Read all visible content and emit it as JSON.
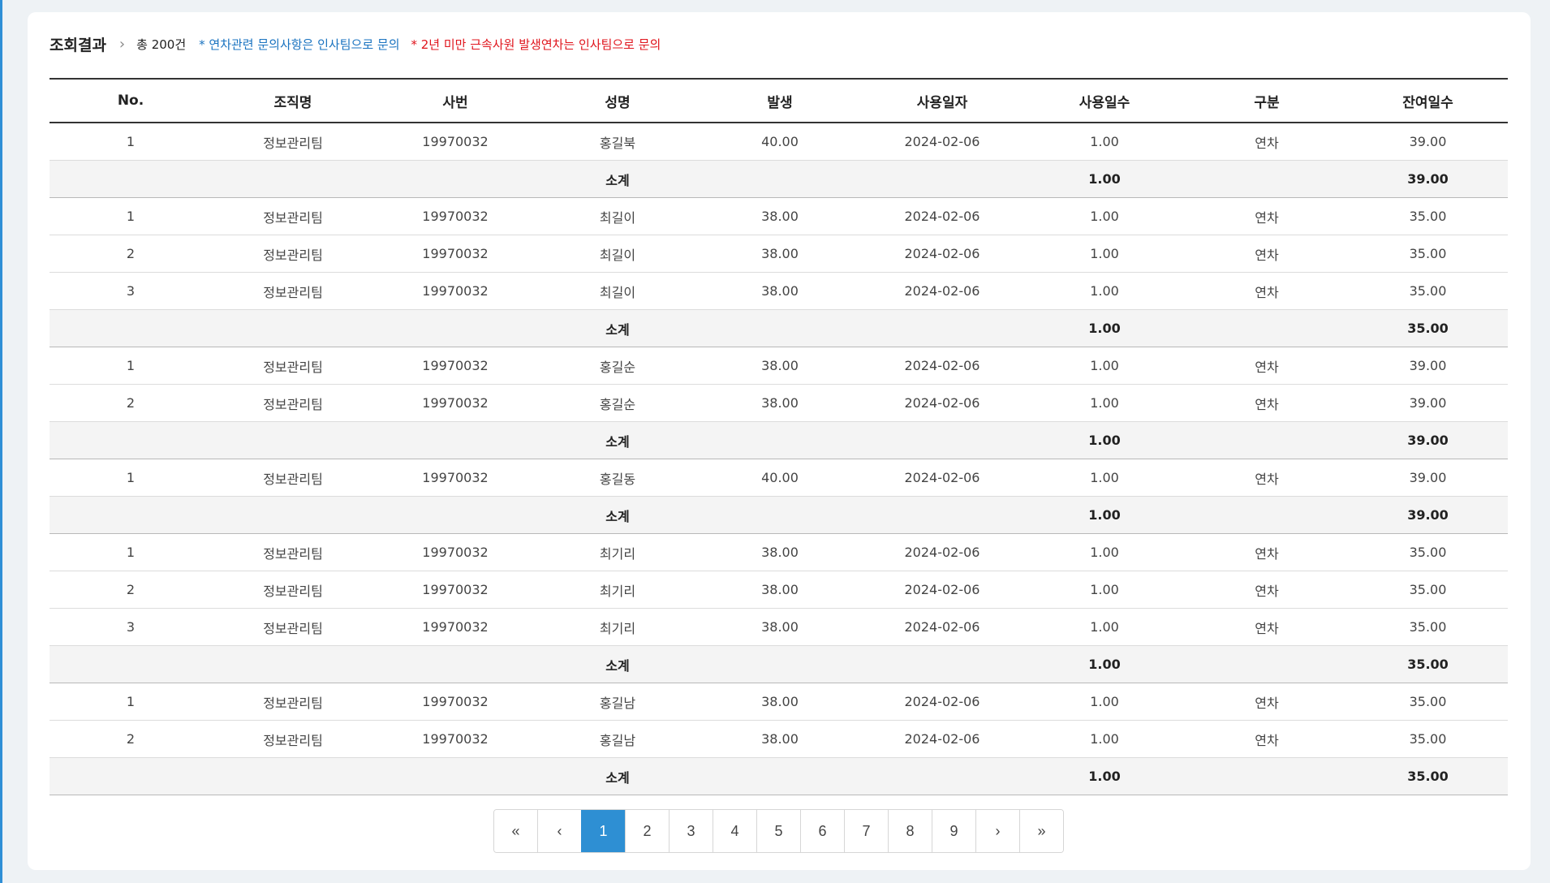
{
  "header": {
    "title": "조회결과",
    "separator": "›",
    "count": "총 200건",
    "note_blue": "* 연차관련 문의사항은 인사팀으로 문의",
    "note_red": "* 2년 미만 근속사원 발생연차는 인사팀으로 문의"
  },
  "table": {
    "columns": [
      "No.",
      "조직명",
      "사번",
      "성명",
      "발생",
      "사용일자",
      "사용일수",
      "구분",
      "잔여일수"
    ],
    "rows": [
      {
        "type": "data",
        "cells": [
          "1",
          "정보관리팀",
          "19970032",
          "홍길북",
          "40.00",
          "2024-02-06",
          "1.00",
          "연차",
          "39.00"
        ]
      },
      {
        "type": "subtotal",
        "label": "소계",
        "used": "1.00",
        "remain": "39.00"
      },
      {
        "type": "data",
        "cells": [
          "1",
          "정보관리팀",
          "19970032",
          "최길이",
          "38.00",
          "2024-02-06",
          "1.00",
          "연차",
          "35.00"
        ]
      },
      {
        "type": "data",
        "cells": [
          "2",
          "정보관리팀",
          "19970032",
          "최길이",
          "38.00",
          "2024-02-06",
          "1.00",
          "연차",
          "35.00"
        ]
      },
      {
        "type": "data",
        "cells": [
          "3",
          "정보관리팀",
          "19970032",
          "최길이",
          "38.00",
          "2024-02-06",
          "1.00",
          "연차",
          "35.00"
        ]
      },
      {
        "type": "subtotal",
        "label": "소계",
        "used": "1.00",
        "remain": "35.00"
      },
      {
        "type": "data",
        "cells": [
          "1",
          "정보관리팀",
          "19970032",
          "홍길순",
          "38.00",
          "2024-02-06",
          "1.00",
          "연차",
          "39.00"
        ]
      },
      {
        "type": "data",
        "cells": [
          "2",
          "정보관리팀",
          "19970032",
          "홍길순",
          "38.00",
          "2024-02-06",
          "1.00",
          "연차",
          "39.00"
        ]
      },
      {
        "type": "subtotal",
        "label": "소계",
        "used": "1.00",
        "remain": "39.00"
      },
      {
        "type": "data",
        "cells": [
          "1",
          "정보관리팀",
          "19970032",
          "홍길동",
          "40.00",
          "2024-02-06",
          "1.00",
          "연차",
          "39.00"
        ]
      },
      {
        "type": "subtotal",
        "label": "소계",
        "used": "1.00",
        "remain": "39.00"
      },
      {
        "type": "data",
        "cells": [
          "1",
          "정보관리팀",
          "19970032",
          "최기리",
          "38.00",
          "2024-02-06",
          "1.00",
          "연차",
          "35.00"
        ]
      },
      {
        "type": "data",
        "cells": [
          "2",
          "정보관리팀",
          "19970032",
          "최기리",
          "38.00",
          "2024-02-06",
          "1.00",
          "연차",
          "35.00"
        ]
      },
      {
        "type": "data",
        "cells": [
          "3",
          "정보관리팀",
          "19970032",
          "최기리",
          "38.00",
          "2024-02-06",
          "1.00",
          "연차",
          "35.00"
        ]
      },
      {
        "type": "subtotal",
        "label": "소계",
        "used": "1.00",
        "remain": "35.00"
      },
      {
        "type": "data",
        "cells": [
          "1",
          "정보관리팀",
          "19970032",
          "홍길남",
          "38.00",
          "2024-02-06",
          "1.00",
          "연차",
          "35.00"
        ]
      },
      {
        "type": "data",
        "cells": [
          "2",
          "정보관리팀",
          "19970032",
          "홍길남",
          "38.00",
          "2024-02-06",
          "1.00",
          "연차",
          "35.00"
        ]
      },
      {
        "type": "subtotal",
        "label": "소계",
        "used": "1.00",
        "remain": "35.00"
      }
    ]
  },
  "pagination": {
    "first_label": "«",
    "prev_label": "‹",
    "pages": [
      "1",
      "2",
      "3",
      "4",
      "5",
      "6",
      "7",
      "8",
      "9"
    ],
    "current": "1",
    "next_label": "›",
    "last_label": "»"
  },
  "colors": {
    "accent": "#2e8fd3",
    "note_blue": "#1a73c0",
    "note_red": "#e0141c"
  }
}
